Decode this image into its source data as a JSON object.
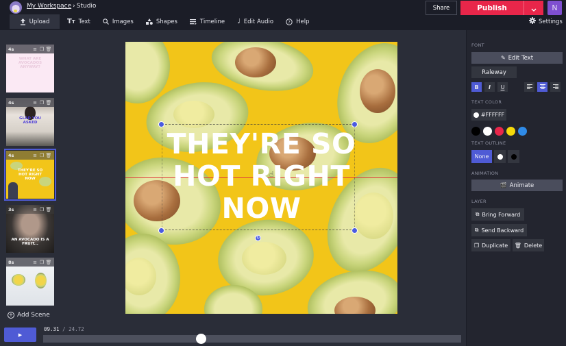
{
  "header": {
    "workspace_link": "My Workspace",
    "separator": "›",
    "current": "Studio",
    "share_label": "Share",
    "publish_label": "Publish",
    "user_initial": "N",
    "settings_label": "Settings",
    "colors": {
      "publish": "#e8264a",
      "accent": "#4f5bd5",
      "user": "#7f4fd0"
    }
  },
  "nav": {
    "items": [
      {
        "label": "Upload",
        "icon": "upload-icon",
        "active": true
      },
      {
        "label": "Text",
        "icon": "text-icon"
      },
      {
        "label": "Images",
        "icon": "search-icon"
      },
      {
        "label": "Shapes",
        "icon": "shapes-icon"
      },
      {
        "label": "Timeline",
        "icon": "timeline-icon"
      },
      {
        "label": "Edit Audio",
        "icon": "music-note-icon"
      },
      {
        "label": "Help",
        "icon": "help-icon"
      }
    ]
  },
  "scenes": {
    "items": [
      {
        "duration": "4s",
        "caption": "WHAT ARE AVOCADOS ANYWAY?"
      },
      {
        "duration": "4s",
        "caption": "GLAD YOU ASKED"
      },
      {
        "duration": "4s",
        "caption": "THEY'RE SO HOT RIGHT NOW",
        "selected": true
      },
      {
        "duration": "3s",
        "caption": "AN AVOCADO IS A FRUIT..."
      },
      {
        "duration": "8s",
        "caption": ""
      }
    ],
    "add_label": "Add Scene"
  },
  "canvas": {
    "text": "THEY'RE SO HOT RIGHT NOW"
  },
  "panel": {
    "font_label": "FONT",
    "edit_text_label": "Edit Text",
    "font_name": "Raleway",
    "style_buttons": [
      {
        "label": "B",
        "active": true
      },
      {
        "label": "I",
        "active": false
      },
      {
        "label": "U",
        "active": false
      }
    ],
    "align_buttons": [
      {
        "name": "align-left",
        "active": false
      },
      {
        "name": "align-center",
        "active": true
      },
      {
        "name": "align-right",
        "active": false
      }
    ],
    "text_color_label": "TEXT COLOR",
    "text_color_value": "#FFFFFF",
    "swatches": [
      "#000000",
      "#ffffff",
      "#e8264a",
      "#f5d90a",
      "#2f8be8"
    ],
    "text_outline_label": "TEXT OUTLINE",
    "outline_none_label": "None",
    "animation_label": "ANIMATION",
    "animate_label": "Animate",
    "layer_label": "LAYER",
    "bring_forward_label": "Bring Forward",
    "send_backward_label": "Send Backward",
    "duplicate_label": "Duplicate",
    "delete_label": "Delete"
  },
  "transport": {
    "current_time": "09.31",
    "total_time": "24.72",
    "progress": 0.3766
  }
}
